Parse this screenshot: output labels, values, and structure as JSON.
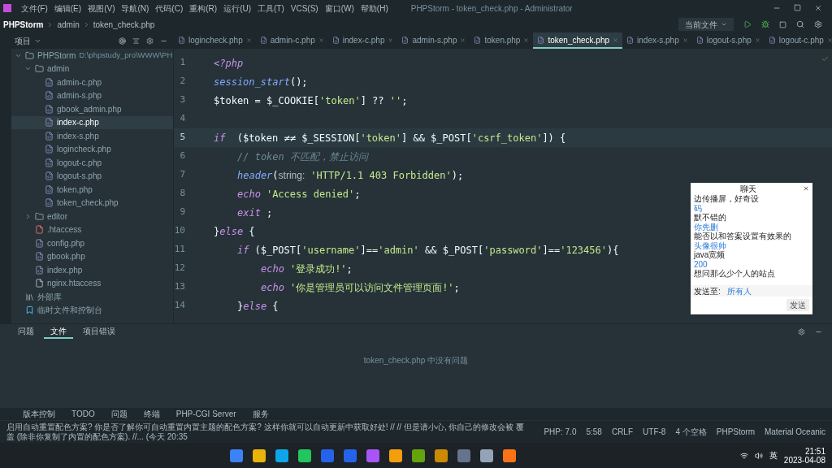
{
  "menu": [
    "文件(F)",
    "编辑(E)",
    "视图(V)",
    "导航(N)",
    "代码(C)",
    "重构(R)",
    "运行(U)",
    "工具(T)",
    "VCS(S)",
    "窗口(W)",
    "帮助(H)"
  ],
  "window": {
    "title": "PHPStorm - token_check.php - Administrator"
  },
  "breadcrumb": [
    "PHPStorm",
    "admin",
    "token_check.php"
  ],
  "run_config": "当前文件",
  "project_panel": {
    "title": "项目"
  },
  "tabs": [
    {
      "label": "logincheck.php",
      "selected": false
    },
    {
      "label": "admin-c.php",
      "selected": false
    },
    {
      "label": "index-c.php",
      "selected": false
    },
    {
      "label": "admin-s.php",
      "selected": false
    },
    {
      "label": "token.php",
      "selected": false
    },
    {
      "label": "token_check.php",
      "selected": true
    },
    {
      "label": "index-s.php",
      "selected": false
    },
    {
      "label": "logout-s.php",
      "selected": false
    },
    {
      "label": "logout-c.php",
      "selected": false
    }
  ],
  "tree": [
    {
      "label": "PHPStorm",
      "path": "D:\\phpstudy_pro\\WWW\\PH",
      "kind": "folder",
      "expanded": true,
      "selected": false,
      "children": [
        {
          "label": "admin",
          "kind": "folder",
          "expanded": true,
          "selected": false,
          "children": [
            {
              "label": "admin-c.php",
              "kind": "php",
              "selected": false
            },
            {
              "label": "admin-s.php",
              "kind": "php",
              "selected": false
            },
            {
              "label": "gbook_admin.php",
              "kind": "php",
              "selected": false
            },
            {
              "label": "index-c.php",
              "kind": "php",
              "selected": true
            },
            {
              "label": "index-s.php",
              "kind": "php",
              "selected": false
            },
            {
              "label": "logincheck.php",
              "kind": "php",
              "selected": false
            },
            {
              "label": "logout-c.php",
              "kind": "php",
              "selected": false
            },
            {
              "label": "logout-s.php",
              "kind": "php",
              "selected": false
            },
            {
              "label": "token.php",
              "kind": "php",
              "selected": false
            },
            {
              "label": "token_check.php",
              "kind": "php",
              "selected": false
            }
          ]
        },
        {
          "label": "editor",
          "kind": "folder",
          "expanded": false,
          "selected": false
        },
        {
          "label": ".htaccess",
          "kind": "config",
          "selected": false
        },
        {
          "label": "config.php",
          "kind": "php",
          "selected": false
        },
        {
          "label": "gbook.php",
          "kind": "php",
          "selected": false
        },
        {
          "label": "index.php",
          "kind": "php",
          "selected": false
        },
        {
          "label": "nginx.htaccess",
          "kind": "text",
          "selected": false
        }
      ]
    },
    {
      "label": "外部库",
      "kind": "library",
      "selected": false
    },
    {
      "label": "临时文件和控制台",
      "kind": "scratch",
      "selected": false
    }
  ],
  "code": [
    {
      "number": "1",
      "current": false,
      "tokens": [
        {
          "kind": "tag",
          "text": "<?php"
        }
      ]
    },
    {
      "number": "2",
      "current": false,
      "tokens": [
        {
          "kind": "func",
          "text": "session_start"
        },
        {
          "kind": "plain",
          "text": "();"
        }
      ]
    },
    {
      "number": "3",
      "current": false,
      "tokens": [
        {
          "kind": "plain",
          "text": "$token = $_COOKIE["
        },
        {
          "kind": "string",
          "text": "'token'"
        },
        {
          "kind": "plain",
          "text": "] ?? "
        },
        {
          "kind": "string",
          "text": "''"
        },
        {
          "kind": "plain",
          "text": ";"
        }
      ]
    },
    {
      "number": "4",
      "current": false
    },
    {
      "number": "5",
      "current": true,
      "tokens": [
        {
          "kind": "keyword",
          "text": "if"
        },
        {
          "kind": "plain",
          "text": " ($token ≠≠ $_SESSION["
        },
        {
          "kind": "string",
          "text": "'token'"
        },
        {
          "kind": "plain",
          "text": "] && $_POST["
        },
        {
          "kind": "string",
          "text": "'csrf_token'"
        },
        {
          "kind": "plain",
          "text": "]) {"
        }
      ],
      "children": [
        {
          "number": "6",
          "current": false,
          "tokens": [
            {
              "kind": "comment",
              "text": "// token 不匹配，禁止访问"
            }
          ]
        },
        {
          "number": "7",
          "current": false,
          "tokens": [
            {
              "kind": "func",
              "text": "header"
            },
            {
              "kind": "plain",
              "text": "("
            },
            {
              "kind": "hint",
              "text": "string:"
            },
            {
              "kind": "string",
              "text": "'HTTP/1.1 403 Forbidden'"
            },
            {
              "kind": "plain",
              "text": ");"
            }
          ]
        },
        {
          "number": "8",
          "current": false,
          "tokens": [
            {
              "kind": "keyword",
              "text": "echo"
            },
            {
              "kind": "string",
              "text": "'Access denied'"
            },
            {
              "kind": "plain",
              "text": ";"
            }
          ]
        },
        {
          "number": "9",
          "current": false,
          "tokens": [
            {
              "kind": "keyword",
              "text": "exit"
            },
            {
              "kind": "plain",
              "text": ";"
            }
          ]
        }
      ]
    },
    {
      "number": "10",
      "current": false,
      "tokens": [
        {
          "kind": "plain",
          "text": "}"
        },
        {
          "kind": "keyword",
          "text": "else"
        },
        {
          "kind": "plain",
          "text": "{"
        }
      ],
      "children": [
        {
          "number": "11",
          "current": false,
          "tokens": [
            {
              "kind": "keyword",
              "text": "if"
            },
            {
              "kind": "plain",
              "text": "($_POST["
            },
            {
              "kind": "string",
              "text": "'username'"
            },
            {
              "kind": "plain",
              "text": "]=="
            },
            {
              "kind": "string",
              "text": "'admin'"
            },
            {
              "kind": "plain",
              "text": " && $_POST["
            },
            {
              "kind": "string",
              "text": "'password'"
            },
            {
              "kind": "plain",
              "text": "]=="
            },
            {
              "kind": "string",
              "text": "'123456'"
            },
            {
              "kind": "plain",
              "text": "){"
            }
          ],
          "children": [
            {
              "number": "12",
              "current": false,
              "tokens": [
                {
                  "kind": "keyword",
                  "text": "echo"
                },
                {
                  "kind": "string",
                  "text": "'登录成功!'"
                },
                {
                  "kind": "plain",
                  "text": ";"
                }
              ]
            },
            {
              "number": "13",
              "current": false,
              "tokens": [
                {
                  "kind": "keyword",
                  "text": "echo"
                },
                {
                  "kind": "string",
                  "text": "'你是管理员可以访问文件管理页面!'"
                },
                {
                  "kind": "plain",
                  "text": ";"
                }
              ]
            }
          ]
        },
        {
          "number": "14",
          "current": false,
          "tokens": [
            {
              "kind": "plain",
              "text": "}"
            },
            {
              "kind": "keyword",
              "text": "else"
            },
            {
              "kind": "plain",
              "text": "{"
            }
          ]
        }
      ]
    }
  ],
  "chat": {
    "title": "聊天",
    "messages": [
      {
        "text": "边传播屏，好奇设",
        "link": false
      },
      {
        "text": "码",
        "link": true
      },
      {
        "text": "默不错的",
        "link": false
      },
      {
        "text": "你先删",
        "link": true
      },
      {
        "text": "能否以和答案设置有效果的",
        "link": false
      },
      {
        "text": "头像很帅",
        "link": true
      },
      {
        "text": "java宽频",
        "link": false
      },
      {
        "text": "200",
        "link": true
      },
      {
        "text": "想问那么少个人的站点",
        "link": false
      }
    ],
    "to_label": "发送至:",
    "to_value": "所有人",
    "send": "发送"
  },
  "problems": {
    "tabs": [
      {
        "label": "问题",
        "selected": false
      },
      {
        "label": "文件",
        "selected": true
      },
      {
        "label": "项目错误",
        "selected": false
      }
    ],
    "empty_text": "token_check.php 中没有问题"
  },
  "tool_windows": [
    "版本控制",
    "TODO",
    "问题",
    "终端",
    "PHP-CGI Server",
    "服务"
  ],
  "status_bar": {
    "message": "启用自动重置配色方案? 你是否了解你可自动重置内置主题的配色方案? 这样你就可以自动更新中获取好处! // // 但是请小心, 你自己的修改会被 覆盖 (除非你复制了内置的配色方案). //... (今天 20:35",
    "items": [
      "PHP: 7.0",
      "5:58",
      "CRLF",
      "UTF-8",
      "4 个空格"
    ],
    "plugin": "PHPStorm",
    "theme": "Material Oceanic"
  },
  "taskbar": {
    "language": "英",
    "time": "21:51",
    "date": "2023-04-08"
  }
}
